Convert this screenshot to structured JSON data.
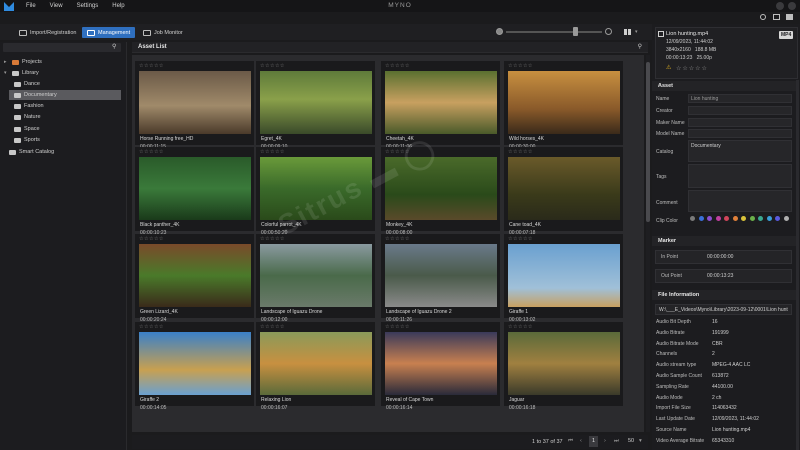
{
  "app": {
    "title": "MYNO",
    "menu": [
      "File",
      "View",
      "Settings",
      "Help"
    ]
  },
  "toolbar": {
    "tabs": [
      {
        "label": "Import/Registration"
      },
      {
        "label": "Management"
      },
      {
        "label": "Job Monitor"
      }
    ]
  },
  "sidebar": {
    "search_placeholder": "",
    "items": [
      {
        "label": "Projects"
      },
      {
        "label": "Library"
      },
      {
        "label": "Dance"
      },
      {
        "label": "Documentary"
      },
      {
        "label": "Fashion"
      },
      {
        "label": "Nature"
      },
      {
        "label": "Space"
      },
      {
        "label": "Sports"
      },
      {
        "label": "Smart Catalog"
      }
    ]
  },
  "asset_list": {
    "title": "Asset List",
    "rating_stars": "☆☆☆☆☆",
    "items": [
      {
        "name": "Horse Running free_HD",
        "duration": "00:00:11:15"
      },
      {
        "name": "Egret_4K",
        "duration": "00:00:09:10"
      },
      {
        "name": "Cheetah_4K",
        "duration": "00:00:11:06"
      },
      {
        "name": "Wild horses_4K",
        "duration": "00:00:30:00"
      },
      {
        "name": "Black panther_4K",
        "duration": "00:00:10:23"
      },
      {
        "name": "Colorful parrot_4K",
        "duration": "00:00:50:20"
      },
      {
        "name": "Monkey_4K",
        "duration": "00:00:08:00"
      },
      {
        "name": "Cane toad_4K",
        "duration": "00:00:07:18"
      },
      {
        "name": "Green Lizard_4K",
        "duration": "00:00:20:24"
      },
      {
        "name": "Landscape of Iguazu Drone",
        "duration": "00:00:12:00"
      },
      {
        "name": "Landscape of Iguazu Drone 2",
        "duration": "00:00:11:26"
      },
      {
        "name": "Giraffe 1",
        "duration": "00:00:13:02"
      },
      {
        "name": "Giraffe 2",
        "duration": "00:00:14:05"
      },
      {
        "name": "Relaxing Lion",
        "duration": "00:00:16:07"
      },
      {
        "name": "Reveal of Cape Town",
        "duration": "00:00:16:14"
      },
      {
        "name": "Jaguar",
        "duration": "00:00:16:18"
      }
    ],
    "pagination": {
      "info": "1 to 37 of 37",
      "current_page": "1",
      "per_page": "50"
    }
  },
  "preview": {
    "filename": "Lion hunting.mp4",
    "date": "12/09/2023, 11:44:02",
    "resolution_size": "3840x2160   188.8 MB",
    "duration_fps": "00:00:13:23   25.00p",
    "format_badge": "MP4",
    "rating_stars": "☆☆☆☆☆"
  },
  "asset_section": {
    "title": "Asset",
    "fields": [
      {
        "label": "Name",
        "value": "Lion hunting"
      },
      {
        "label": "Creator",
        "value": ""
      },
      {
        "label": "Maker Name",
        "value": ""
      },
      {
        "label": "Model Name",
        "value": ""
      },
      {
        "label": "Catalog",
        "value": "Documentary"
      },
      {
        "label": "Tags",
        "value": ""
      },
      {
        "label": "Comment",
        "value": ""
      },
      {
        "label": "Clip Color",
        "value": ""
      }
    ],
    "clip_colors": [
      "#7a7a7a",
      "#3a6fd8",
      "#8a4fd0",
      "#c03fa0",
      "#d0455a",
      "#e0803a",
      "#d8c23a",
      "#6ab04a",
      "#3aa890",
      "#3a9ed8",
      "#5a5ae0",
      "#b0b0b0"
    ]
  },
  "marker": {
    "title": "Marker",
    "in_label": "In Point",
    "in_value": "00:00:00:00",
    "out_label": "Out Point",
    "out_value": "00:00:13:23"
  },
  "file_info": {
    "title": "File Information",
    "path": "W:\\___E_Videos\\Myno\\Library\\2023-09-12\\0001\\Lion hunt",
    "rows": [
      {
        "label": "Audio Bit Depth",
        "value": "16"
      },
      {
        "label": "Audio Bitrate",
        "value": "191999"
      },
      {
        "label": "Audio Bitrate Mode",
        "value": "CBR"
      },
      {
        "label": "Channels",
        "value": "2"
      },
      {
        "label": "Audio stream type",
        "value": "MPEG-4 AAC LC"
      },
      {
        "label": "Audio Sample Count",
        "value": "613872"
      },
      {
        "label": "Sampling Rate",
        "value": "44100.00"
      },
      {
        "label": "Audio Mode",
        "value": "2 ch"
      },
      {
        "label": "Import File Size",
        "value": "114063432"
      },
      {
        "label": "Last Update Date",
        "value": "12/09/2023, 11:44:02"
      },
      {
        "label": "Source Name",
        "value": "Lion hunting.mp4"
      },
      {
        "label": "Video Average Bitrate",
        "value": "65343310"
      }
    ]
  }
}
